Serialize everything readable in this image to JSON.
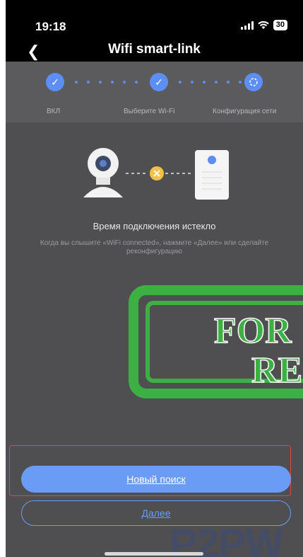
{
  "status_bar": {
    "time": "19:18",
    "battery": "30"
  },
  "header": {
    "back_icon": "chevron-left-icon",
    "title": "Wifi smart-link"
  },
  "steps": [
    {
      "label": "ВКЛ",
      "state": "done"
    },
    {
      "label": "Выберите Wi-Fi",
      "state": "done"
    },
    {
      "label": "Конфигурация сети",
      "state": "active"
    }
  ],
  "message": {
    "title": "Время подключения истекло",
    "subtitle": "Когда вы слышите «WiFi connected», нажмите «Далее» или сделайте реконфигурацию"
  },
  "buttons": {
    "new_search": "Новый поиск",
    "next": "Далее"
  },
  "stamp": {
    "line1": "FOR",
    "line2": "RE"
  },
  "watermark": "P2PW",
  "colors": {
    "accent": "#5d8ef5",
    "button": "#6b9cf5",
    "highlight": "#e0444b",
    "stamp": "#3cb043"
  }
}
